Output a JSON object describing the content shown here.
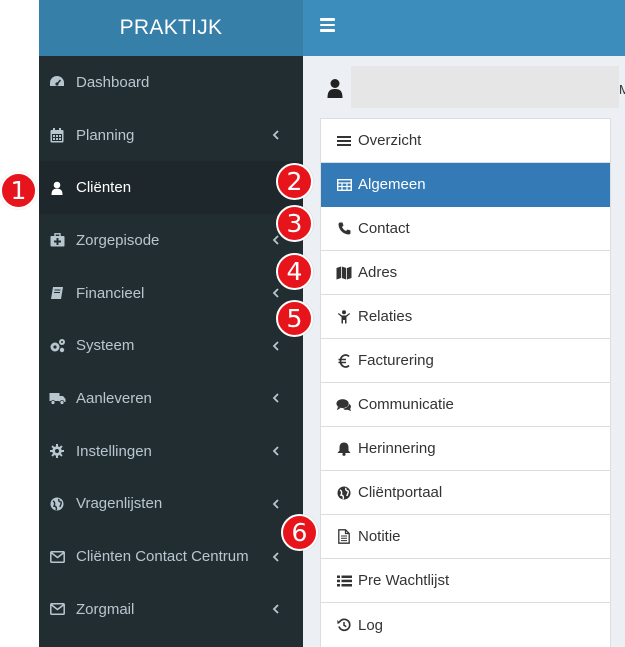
{
  "brand": {
    "title": "PRAKTIJK"
  },
  "sidebar": {
    "items": [
      {
        "label": "Dashboard",
        "icon": "dashboard-icon"
      },
      {
        "label": "Planning",
        "icon": "calendar-icon"
      },
      {
        "label": "Cliënten",
        "icon": "user-icon",
        "active": true
      },
      {
        "label": "Zorgepisode",
        "icon": "medkit-icon"
      },
      {
        "label": "Financieel",
        "icon": "book-icon"
      },
      {
        "label": "Systeem",
        "icon": "cogs-icon"
      },
      {
        "label": "Aanleveren",
        "icon": "truck-icon"
      },
      {
        "label": "Instellingen",
        "icon": "gear-icon"
      },
      {
        "label": "Vragenlijsten",
        "icon": "globe-icon"
      },
      {
        "label": "Cliënten Contact Centrum",
        "icon": "envelope-icon"
      },
      {
        "label": "Zorgmail",
        "icon": "envelope-icon"
      }
    ]
  },
  "client": {
    "trailing": "M"
  },
  "tabs": [
    {
      "label": "Overzicht",
      "icon": "list-icon"
    },
    {
      "label": "Algemeen",
      "icon": "table-icon",
      "active": true
    },
    {
      "label": "Contact",
      "icon": "phone-icon"
    },
    {
      "label": "Adres",
      "icon": "map-icon"
    },
    {
      "label": "Relaties",
      "icon": "child-icon"
    },
    {
      "label": "Facturering",
      "icon": "euro-icon"
    },
    {
      "label": "Communicatie",
      "icon": "comments-icon"
    },
    {
      "label": "Herinnering",
      "icon": "bell-icon"
    },
    {
      "label": "Cliëntportaal",
      "icon": "globe-icon"
    },
    {
      "label": "Notitie",
      "icon": "file-text-icon"
    },
    {
      "label": "Pre Wachtlijst",
      "icon": "list-ul-icon"
    },
    {
      "label": "Log",
      "icon": "history-icon"
    }
  ],
  "badges": [
    "1",
    "2",
    "3",
    "4",
    "5",
    "6"
  ],
  "colors": {
    "sidebar_bg": "#222d32",
    "brand_bg": "#367fa9",
    "topbar_bg": "#3c8dbc",
    "active_tab": "#337ab7",
    "badge": "#e8141c"
  }
}
